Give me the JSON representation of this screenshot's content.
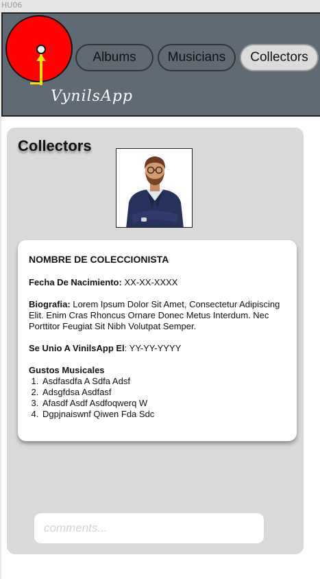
{
  "frame": {
    "label": "HU06"
  },
  "header": {
    "brand": "VynilsApp",
    "nav": [
      {
        "label": "Albums"
      },
      {
        "label": "Musicians"
      },
      {
        "label": "Collectors",
        "active": true
      }
    ]
  },
  "main": {
    "title": "Collectors",
    "collector": {
      "name": "NOMBRE DE COLECCIONISTA",
      "birth_label": "Fecha De Nacimiento:",
      "birth_value": "XX-XX-XXXX",
      "bio_label": "Biografia:",
      "bio_value": "Lorem Ipsum Dolor Sit Amet, Consectetur Adipiscing Elit. Enim Cras Rhoncus Ornare Donec Metus Interdum. Nec Porttitor Feugiat Sit Nibh Volutpat Semper.",
      "joined_label": "Se Unio A VinilsApp El",
      "joined_value": ": YY-YY-YYYY",
      "genres_label": "Gustos Musicales",
      "genres": [
        "Asdfasdfa A Sdfa Adsf",
        "Adsgfdsa  Asdfasf",
        "Afasdf Asdf Asdfoqwerq W",
        "Dgpjnaiswnf Qiwen Fda Sdc"
      ]
    },
    "comments_placeholder": "comments..."
  },
  "colors": {
    "header_bg": "#5f6a75",
    "panel_bg": "#d9d9d9",
    "logo_red": "#ff0000",
    "logo_yellow": "#f5e400"
  }
}
